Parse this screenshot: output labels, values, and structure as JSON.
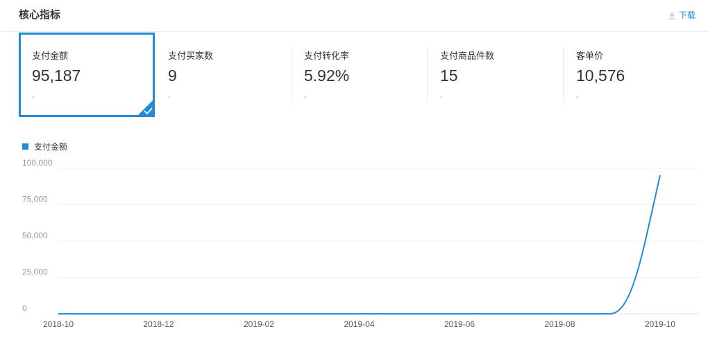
{
  "header": {
    "title": "核心指标",
    "download_label": "下载",
    "download_icon": "download-icon"
  },
  "metrics": [
    {
      "label": "支付金额",
      "value": "95,187",
      "sub": "-",
      "selected": true
    },
    {
      "label": "支付买家数",
      "value": "9",
      "sub": "-",
      "selected": false
    },
    {
      "label": "支付转化率",
      "value": "5.92%",
      "sub": "-",
      "selected": false
    },
    {
      "label": "支付商品件数",
      "value": "15",
      "sub": "-",
      "selected": false
    },
    {
      "label": "客单价",
      "value": "10,576",
      "sub": "-",
      "selected": false
    }
  ],
  "colors": {
    "accent": "#1f8bd9",
    "grid": "#f0f0f0",
    "axis_text": "#999999"
  },
  "chart_data": {
    "type": "line",
    "legend": [
      "支付金额"
    ],
    "legend_position": "top-left",
    "grid": true,
    "ylim": [
      0,
      100000
    ],
    "yticks": [
      "100,000",
      "75,000",
      "50,000",
      "25,000",
      "0"
    ],
    "xticks": [
      "2018-10",
      "2018-12",
      "2019-02",
      "2019-04",
      "2019-06",
      "2019-08",
      "2019-10"
    ],
    "series": [
      {
        "name": "支付金额",
        "x": [
          "2018-10",
          "2018-11",
          "2018-12",
          "2019-01",
          "2019-02",
          "2019-03",
          "2019-04",
          "2019-05",
          "2019-06",
          "2019-07",
          "2019-08",
          "2019-09",
          "2019-10"
        ],
        "values": [
          0,
          0,
          0,
          0,
          0,
          0,
          0,
          0,
          0,
          0,
          0,
          0,
          95187
        ]
      }
    ]
  }
}
